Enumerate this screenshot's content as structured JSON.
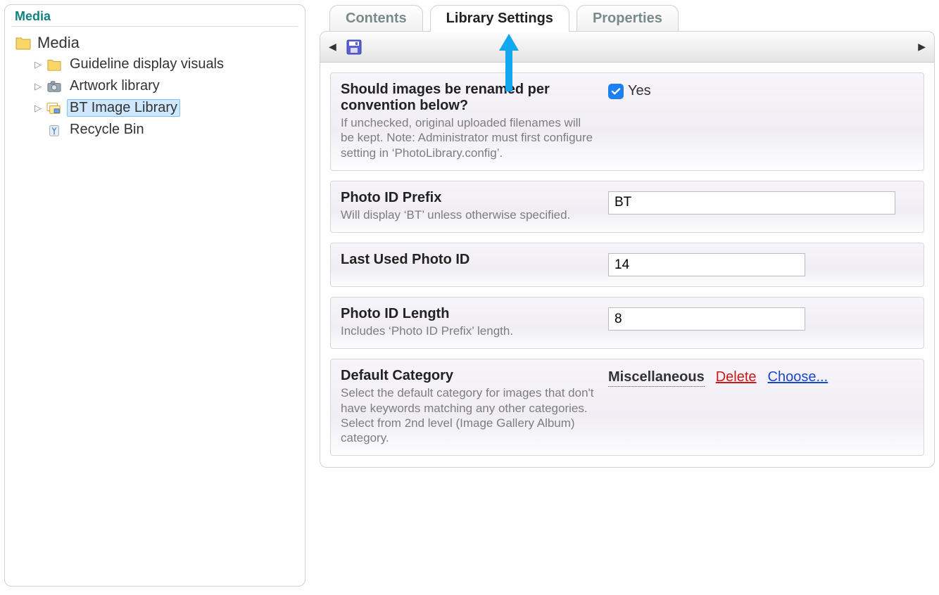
{
  "sidebar": {
    "title": "Media",
    "root": "Media",
    "items": [
      {
        "label": "Guideline display visuals",
        "icon": "folder-visuals",
        "expandable": true,
        "selected": false
      },
      {
        "label": "Artwork library",
        "icon": "camera",
        "expandable": true,
        "selected": false
      },
      {
        "label": "BT Image Library",
        "icon": "image-lib",
        "expandable": true,
        "selected": true
      },
      {
        "label": "Recycle Bin",
        "icon": "recycle",
        "expandable": false,
        "selected": false
      }
    ]
  },
  "tabs": {
    "items": [
      {
        "label": "Contents",
        "active": false
      },
      {
        "label": "Library Settings",
        "active": true
      },
      {
        "label": "Properties",
        "active": false
      }
    ]
  },
  "toolbar": {
    "save_icon": "save"
  },
  "settings": {
    "rename": {
      "title": "Should images be renamed per convention below?",
      "desc": "If unchecked, original uploaded filenames will be kept. Note: Administrator must first configure setting in ‘PhotoLibrary.config’.",
      "checkbox_label": "Yes",
      "checked": true
    },
    "prefix": {
      "title": "Photo ID Prefix",
      "desc": "Will display ‘BT’ unless otherwise specified.",
      "value": "BT"
    },
    "last_used": {
      "title": "Last Used Photo ID",
      "value": "14"
    },
    "length": {
      "title": "Photo ID Length",
      "desc": "Includes ‘Photo ID Prefix’ length.",
      "value": "8"
    },
    "default_category": {
      "title": "Default Category",
      "desc": "Select the default category for images that don't have keywords matching any other categories. Select from 2nd level (Image Gallery Album) category.",
      "value": "Miscellaneous",
      "delete_label": "Delete",
      "choose_label": "Choose..."
    }
  }
}
